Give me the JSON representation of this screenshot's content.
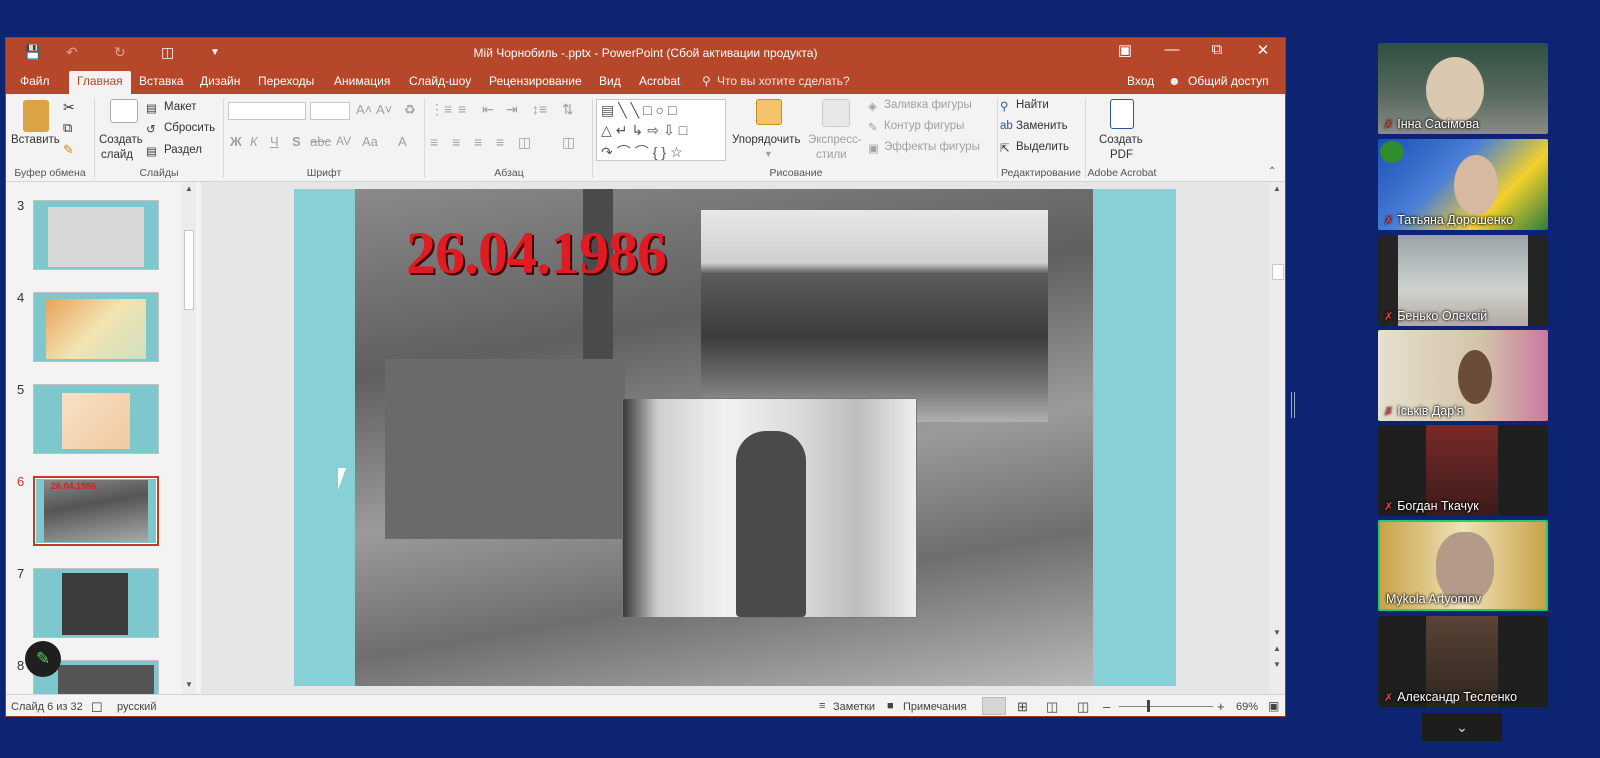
{
  "window": {
    "title": "Мій Чорнобиль -.pptx - PowerPoint (Сбой активации продукта)"
  },
  "menu": {
    "items": [
      "Файл",
      "Главная",
      "Вставка",
      "Дизайн",
      "Переходы",
      "Анимация",
      "Слайд-шоу",
      "Рецензирование",
      "Вид",
      "Acrobat"
    ],
    "tell_me": "Что вы хотите сделать?",
    "signin": "Вход",
    "share": "Общий доступ"
  },
  "ribbon": {
    "clipboard": {
      "paste": "Вставить",
      "label": "Буфер обмена"
    },
    "slides": {
      "new_slide_1": "Создать",
      "new_slide_2": "слайд",
      "layout": "Макет",
      "reset": "Сбросить",
      "section": "Раздел",
      "label": "Слайды"
    },
    "font": {
      "label": "Шрифт",
      "bold": "Ж",
      "italic": "К",
      "underline": "Ч",
      "strike": "S",
      "case": "Aa"
    },
    "paragraph": {
      "label": "Абзац"
    },
    "drawing": {
      "arrange": "Упорядочить",
      "styles_1": "Экспресс-",
      "styles_2": "стили",
      "fill": "Заливка фигуры",
      "outline": "Контур фигуры",
      "effects": "Эффекты фигуры",
      "label": "Рисование"
    },
    "editing": {
      "find": "Найти",
      "replace": "Заменить",
      "select": "Выделить",
      "label": "Редактирование"
    },
    "acrobat": {
      "create_1": "Создать",
      "create_2": "PDF",
      "label": "Adobe Acrobat"
    }
  },
  "thumbnails": [
    {
      "num": "3"
    },
    {
      "num": "4"
    },
    {
      "num": "5"
    },
    {
      "num": "6"
    },
    {
      "num": "7"
    },
    {
      "num": "8"
    }
  ],
  "slide": {
    "date": "26.04.1986",
    "thumb_date": "26.04.1986"
  },
  "status": {
    "slide_counter": "Слайд 6 из 32",
    "language": "русский",
    "notes": "Заметки",
    "comments": "Примечания",
    "zoom": "69%"
  },
  "participants": [
    {
      "name": "Інна Сасімова",
      "muted": true
    },
    {
      "name": "Татьяна Дорошенко",
      "muted": true
    },
    {
      "name": "Бенько Олексій",
      "muted": true
    },
    {
      "name": "Іськів Дар'я",
      "muted": true
    },
    {
      "name": "Богдан Ткачук",
      "muted": true
    },
    {
      "name": "Mykola Artyomov",
      "muted": false
    },
    {
      "name": "Александр Тесленко",
      "muted": true
    }
  ],
  "colors": {
    "ppt_accent": "#b7472a",
    "zoom_bg": "#0c2472",
    "active_speaker": "#1ed06a"
  }
}
